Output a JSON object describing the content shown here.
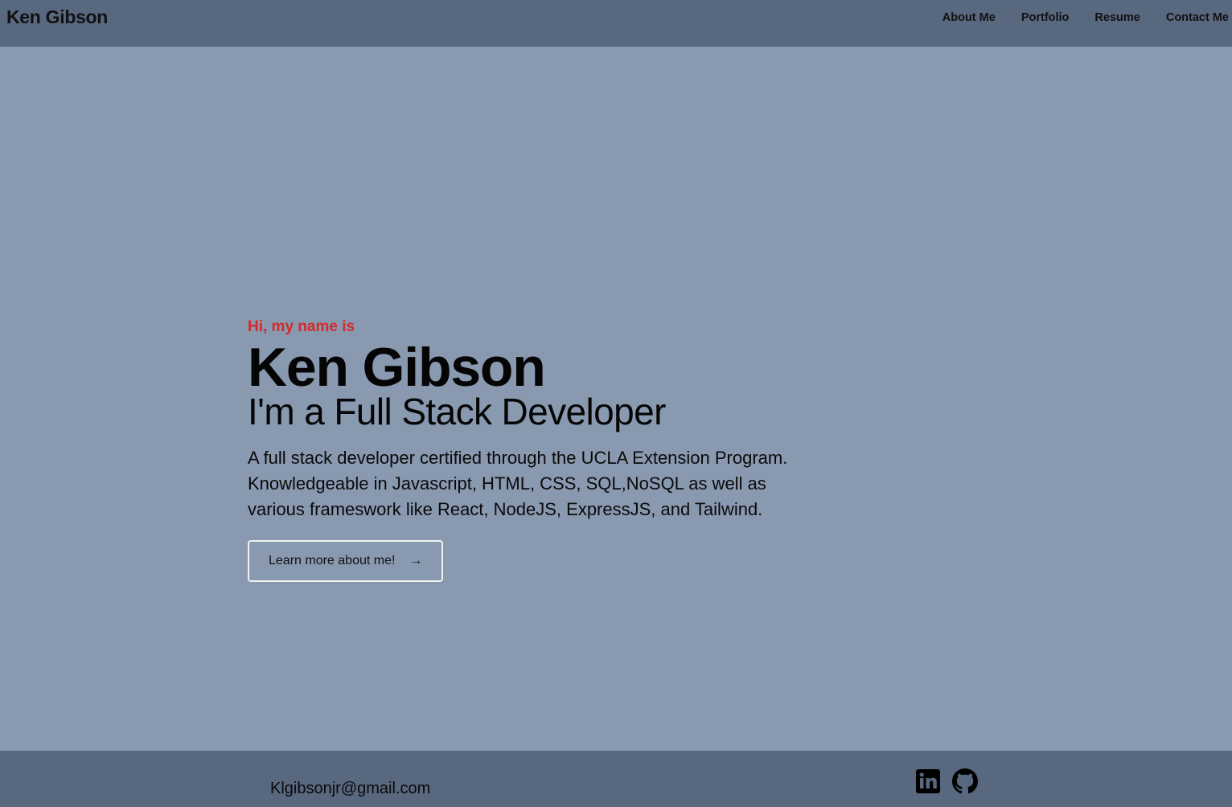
{
  "header": {
    "brand": "Ken Gibson",
    "nav": [
      {
        "label": "About Me"
      },
      {
        "label": "Portfolio"
      },
      {
        "label": "Resume"
      },
      {
        "label": "Contact Me"
      }
    ]
  },
  "hero": {
    "greeting": "Hi, my name is",
    "name": "Ken Gibson",
    "role": "I'm a Full Stack Developer",
    "description": "A full stack developer certified through the UCLA Extension Program. Knowledgeable in Javascript, HTML, CSS, SQL,NoSQL as well as various frameswork like React, NodeJS, ExpressJS, and Tailwind.",
    "button_label": "Learn more about me!",
    "button_icon": "→"
  },
  "footer": {
    "email": "Klgibsonjr@gmail.com",
    "social_icons": [
      "linkedin-icon",
      "github-icon"
    ]
  },
  "colors": {
    "background": "#8899b0",
    "bars": "#58687f",
    "accent": "#d42a2a"
  }
}
